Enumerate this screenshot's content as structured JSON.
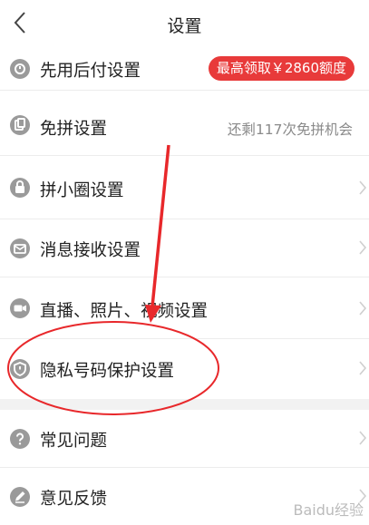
{
  "header": {
    "title": "设置",
    "back_icon": "chevron-left-icon"
  },
  "items": [
    {
      "label": "先用后付设置",
      "icon": "credit-badge-icon",
      "badge": "最高领取￥2860额度"
    },
    {
      "label": "免拼设置",
      "icon": "copy-icon",
      "right_text": "还剩117次免拼机会"
    },
    {
      "label": "拼小圈设置",
      "icon": "lock-icon"
    },
    {
      "label": "消息接收设置",
      "icon": "message-icon"
    },
    {
      "label": "直播、照片、视频设置",
      "icon": "camera-icon"
    },
    {
      "label": "隐私号码保护设置",
      "icon": "shield-icon"
    }
  ],
  "items2": [
    {
      "label": "常见问题",
      "icon": "question-icon"
    },
    {
      "label": "意见反馈",
      "icon": "feedback-pencil-icon"
    }
  ],
  "watermark": {
    "text": "Baidu经验"
  },
  "colors": {
    "badge": "#e83a3a",
    "icon": "#9a9a9a",
    "annotation": "#e8282b"
  }
}
